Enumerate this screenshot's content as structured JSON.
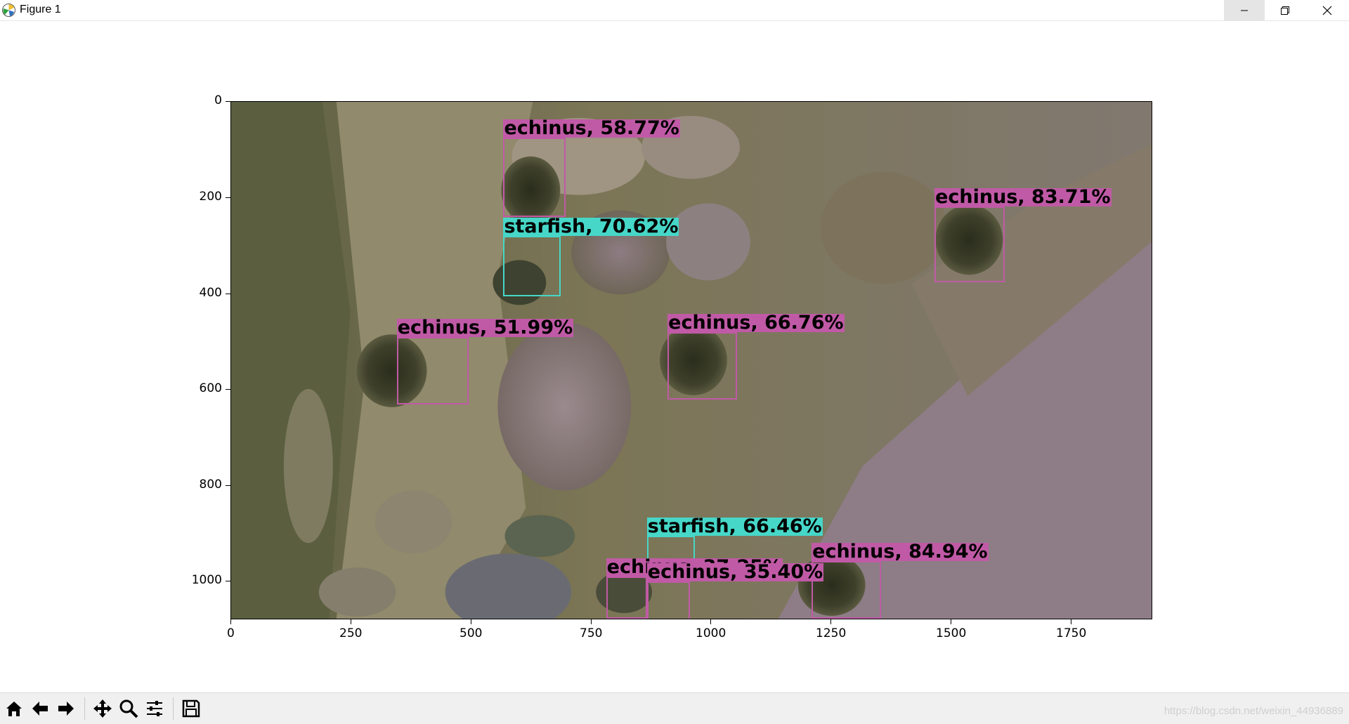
{
  "window": {
    "title": "Figure 1"
  },
  "figure": {
    "x_ticks": [
      "0",
      "250",
      "500",
      "750",
      "1000",
      "1250",
      "1500",
      "1750"
    ],
    "y_ticks": [
      "0",
      "200",
      "400",
      "600",
      "800",
      "1000"
    ]
  },
  "detections": [
    {
      "class": "echinus",
      "label": "echinus, 58.77%",
      "color": "#c05aa6"
    },
    {
      "class": "echinus",
      "label": "echinus, 83.71%",
      "color": "#c05aa6"
    },
    {
      "class": "starfish",
      "label": "starfish, 70.62%",
      "color": "#46d7c8"
    },
    {
      "class": "echinus",
      "label": "echinus, 51.99%",
      "color": "#c05aa6"
    },
    {
      "class": "echinus",
      "label": "echinus, 66.76%",
      "color": "#c05aa6"
    },
    {
      "class": "starfish",
      "label": "starfish, 66.46%",
      "color": "#46d7c8"
    },
    {
      "class": "echinus",
      "label": "echinus, 84.94%",
      "color": "#c05aa6"
    },
    {
      "class": "echinus",
      "label": "echinus, 37.25%",
      "color": "#c05aa6"
    },
    {
      "class": "echinus",
      "label": "echinus, 35.40%",
      "color": "#c05aa6"
    }
  ],
  "toolbar": {
    "tools": [
      "home-icon",
      "back-arrow-icon",
      "forward-arrow-icon",
      "pan-icon",
      "zoom-icon",
      "configure-subplots-icon",
      "save-icon"
    ]
  },
  "watermark": "https://blog.csdn.net/weixin_44936889"
}
